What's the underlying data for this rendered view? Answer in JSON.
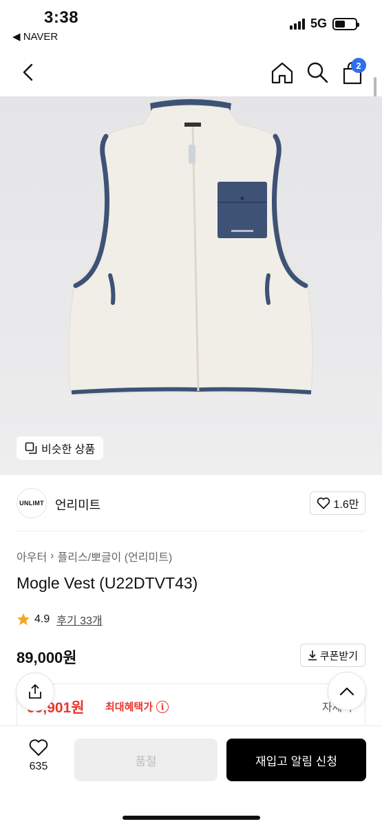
{
  "status_bar": {
    "time": "3:38",
    "back_app": "◀ NAVER",
    "network": "5G"
  },
  "nav": {
    "cart_count": "2",
    "icons": [
      "back-arrow-icon",
      "home-icon",
      "search-icon",
      "cart-icon"
    ]
  },
  "product_image": {
    "similar_button_label": "비슷한 상품",
    "colors": {
      "fleece": "#f1eee7",
      "trim": "#3e5276",
      "background": "#e8e8ea"
    }
  },
  "brand": {
    "logo_text": "UNLIMT",
    "name": "언리미트",
    "likes": "1.6만"
  },
  "breadcrumb": [
    "아우터",
    "플리스/뽀글이 (언리미트)"
  ],
  "product": {
    "title": "Mogle Vest (U22DTVT43)",
    "rating": "4.9",
    "review_link": "후기 33개",
    "price": "89,000원",
    "coupon_label": "쿠폰받기"
  },
  "benefit": {
    "price": "69,901원",
    "label": "최대혜택가",
    "detail": "자세히"
  },
  "bottom_bar": {
    "wish_count": "635",
    "soldout_label": "품절",
    "restock_label": "재입고 알림 신청"
  },
  "colors": {
    "accent_red": "#e8372c",
    "badge_blue": "#2f6fef",
    "star": "#f5a623"
  }
}
